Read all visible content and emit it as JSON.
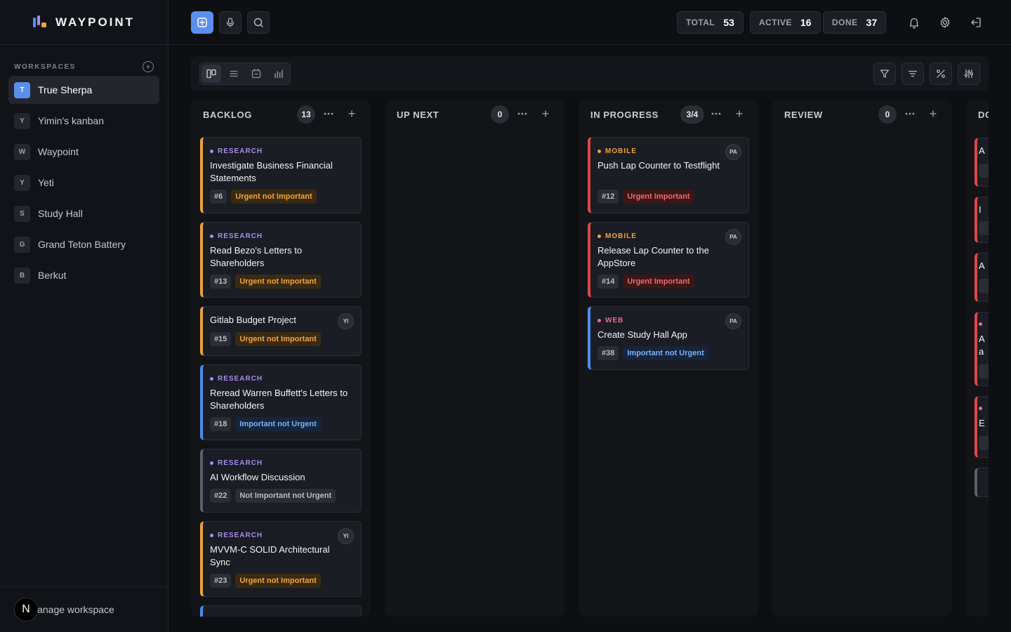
{
  "brand": {
    "name": "WAYPOINT"
  },
  "sidebar": {
    "section_label": "WORKSPACES",
    "workspaces": [
      {
        "initial": "T",
        "name": "True Sherpa",
        "active": true
      },
      {
        "initial": "Y",
        "name": "Yimin's kanban"
      },
      {
        "initial": "W",
        "name": "Waypoint"
      },
      {
        "initial": "Y",
        "name": "Yeti"
      },
      {
        "initial": "S",
        "name": "Study Hall"
      },
      {
        "initial": "G",
        "name": "Grand Teton Battery"
      },
      {
        "initial": "B",
        "name": "Berkut"
      }
    ],
    "footer": {
      "avatar": "N",
      "label": "lanage workspace"
    }
  },
  "topbar": {
    "stats": [
      {
        "label": "TOTAL",
        "value": "53"
      },
      {
        "label": "ACTIVE",
        "value": "16"
      },
      {
        "label": "DONE",
        "value": "37"
      }
    ]
  },
  "columns": [
    {
      "title": "BACKLOG",
      "count": "13",
      "cards": [
        {
          "tag": "RESEARCH",
          "title": "Investigate Business Financial Statements",
          "id": "#6",
          "priority": "Urgent not Important"
        },
        {
          "tag": "RESEARCH",
          "title": "Read Bezo's Letters to Shareholders",
          "id": "#13",
          "priority": "Urgent not Important"
        },
        {
          "title": "Gitlab Budget Project",
          "id": "#15",
          "priority": "Urgent not Important",
          "avatar": "YI"
        },
        {
          "tag": "RESEARCH",
          "title": "Reread Warren Buffett's Letters to Shareholders",
          "id": "#18",
          "priority": "Important not Urgent"
        },
        {
          "tag": "RESEARCH",
          "title": "AI Workflow Discussion",
          "id": "#22",
          "priority": "Not Important not Urgent"
        },
        {
          "tag": "RESEARCH",
          "title": "MVVM-C SOLID Architectural Sync",
          "id": "#23",
          "priority": "Urgent not Important",
          "avatar": "YI"
        }
      ]
    },
    {
      "title": "UP NEXT",
      "count": "0",
      "cards": []
    },
    {
      "title": "IN PROGRESS",
      "count": "3/4",
      "cards": [
        {
          "tag": "MOBILE",
          "title": "Push Lap Counter to Testflight",
          "id": "#12",
          "priority": "Urgent Important",
          "avatar": "PA"
        },
        {
          "tag": "MOBILE",
          "title": "Release Lap Counter to the AppStore",
          "id": "#14",
          "priority": "Urgent Important",
          "avatar": "PA"
        },
        {
          "tag": "WEB",
          "title": "Create Study Hall App",
          "id": "#38",
          "priority": "Important not Urgent",
          "avatar": "PA"
        }
      ]
    },
    {
      "title": "REVIEW",
      "count": "0",
      "cards": []
    },
    {
      "title": "DC",
      "cards": [
        {
          "title_fragment": "A"
        },
        {
          "title_fragment": "I"
        },
        {
          "title_fragment": "A"
        },
        {
          "title_fragment": "A",
          "title_fragment_2": "a"
        },
        {
          "title_fragment": "E"
        }
      ]
    }
  ],
  "colors": {
    "accent": "#5a8ff0",
    "research": "#a88cf0",
    "mobile": "#f0a43a",
    "web": "#f06a8a",
    "urgent_not_important": "#f0a43a",
    "urgent_important": "#f06a6a",
    "important_not_urgent": "#7fb0f5"
  }
}
